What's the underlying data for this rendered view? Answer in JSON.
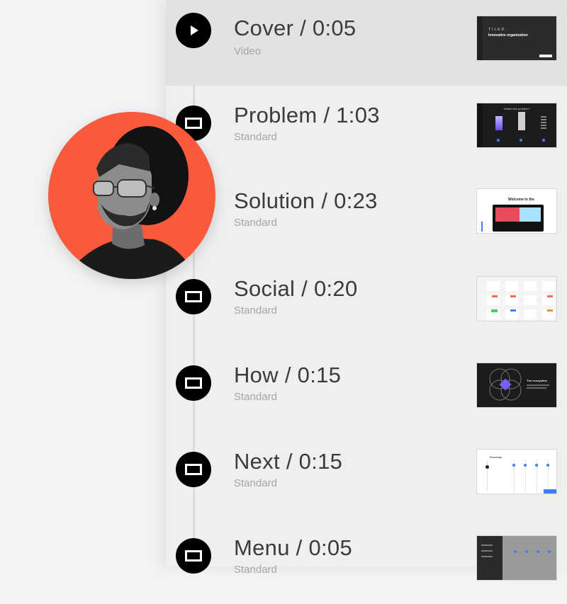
{
  "slides": [
    {
      "title": "Cover / 0:05",
      "type": "Video",
      "icon": "play-icon",
      "active": true
    },
    {
      "title": "Problem / 1:03",
      "type": "Standard",
      "icon": "slide-icon"
    },
    {
      "title": "Solution / 0:23",
      "type": "Standard",
      "icon": "slide-icon"
    },
    {
      "title": "Social / 0:20",
      "type": "Standard",
      "icon": "slide-icon"
    },
    {
      "title": "How / 0:15",
      "type": "Standard",
      "icon": "slide-icon"
    },
    {
      "title": "Next / 0:15",
      "type": "Standard",
      "icon": "slide-icon"
    },
    {
      "title": "Menu / 0:05",
      "type": "Standard",
      "icon": "slide-icon"
    }
  ],
  "thumbnails": {
    "cover_brand": "TILED·",
    "cover_headline": "Innovative organization",
    "problem_heading": "What's the problem?",
    "solution_heading": "Welcome to the",
    "how_heading": "The ecosystem",
    "next_heading": "Roadmap"
  },
  "colors": {
    "accent": "#fa5a3c",
    "row_active": "#e2e2e2",
    "timeline": "#dcdcdc",
    "icon_bg": "#000000",
    "thumb_accent": "#7b5cff",
    "blue": "#3d7eff"
  }
}
